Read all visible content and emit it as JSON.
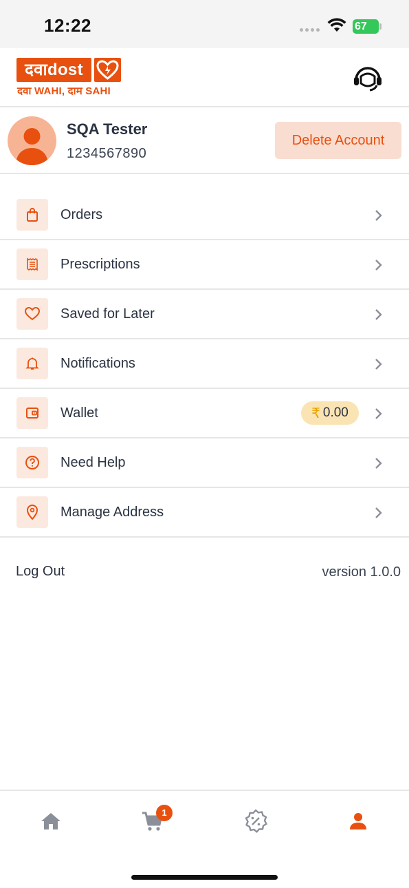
{
  "status_bar": {
    "time": "12:22",
    "battery": "67"
  },
  "brand": {
    "logo_text": "दवाdost",
    "tagline": "दवा WAHI, दाम SAHI",
    "accent_color": "#e8500f"
  },
  "header": {
    "support_icon": "headset-icon"
  },
  "profile": {
    "name": "SQA Tester",
    "phone": "1234567890",
    "delete_label": "Delete Account"
  },
  "menu": [
    {
      "label": "Orders",
      "icon": "shopping-bag-icon"
    },
    {
      "label": "Prescriptions",
      "icon": "receipt-icon"
    },
    {
      "label": "Saved for Later",
      "icon": "heart-icon"
    },
    {
      "label": "Notifications",
      "icon": "bell-icon"
    },
    {
      "label": "Wallet",
      "icon": "wallet-icon",
      "badge_symbol": "₹",
      "badge_value": "0.00"
    },
    {
      "label": "Need Help",
      "icon": "help-circle-icon"
    },
    {
      "label": "Manage Address",
      "icon": "location-pin-icon"
    }
  ],
  "footer": {
    "logout_label": "Log Out",
    "version": "version 1.0.0"
  },
  "bottom_nav": {
    "items": [
      "home-icon",
      "cart-icon",
      "offers-icon",
      "profile-icon"
    ],
    "cart_count": "1",
    "active": "profile"
  }
}
